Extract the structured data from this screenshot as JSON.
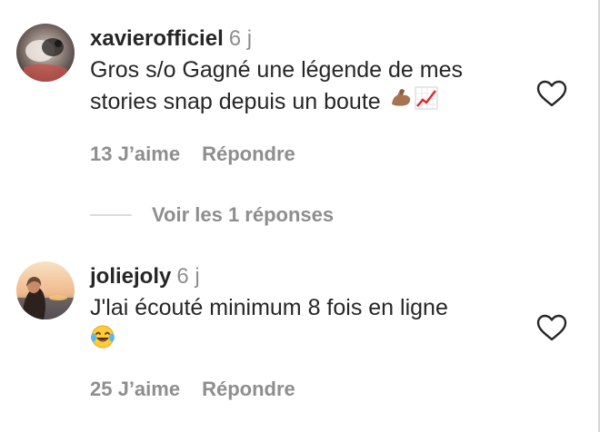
{
  "comments": [
    {
      "username": "xavierofficiel",
      "time": "6 j",
      "text_line1": "Gros s/o Gagné une légende de mes",
      "text_line2": "stories snap depuis un boute",
      "emojis": [
        "flexed-biceps",
        "chart-increasing"
      ],
      "likes_label": "13 J’aime",
      "reply_label": "Répondre",
      "avatar_icon": "avatar-photo"
    },
    {
      "username": "joliejoly",
      "time": "6 j",
      "text_line1": "J'lai écouté minimum 8 fois en ligne",
      "emojis": [
        "face-with-tears-of-joy"
      ],
      "likes_label": "25 J’aime",
      "reply_label": "Répondre",
      "avatar_icon": "avatar-photo"
    }
  ],
  "view_replies_label": "Voir les 1 réponses",
  "icons": {
    "like": "heart-outline-icon"
  },
  "colors": {
    "primary_text": "#262626",
    "secondary_text": "#8e8e8e",
    "divider": "#dbdbdb"
  }
}
